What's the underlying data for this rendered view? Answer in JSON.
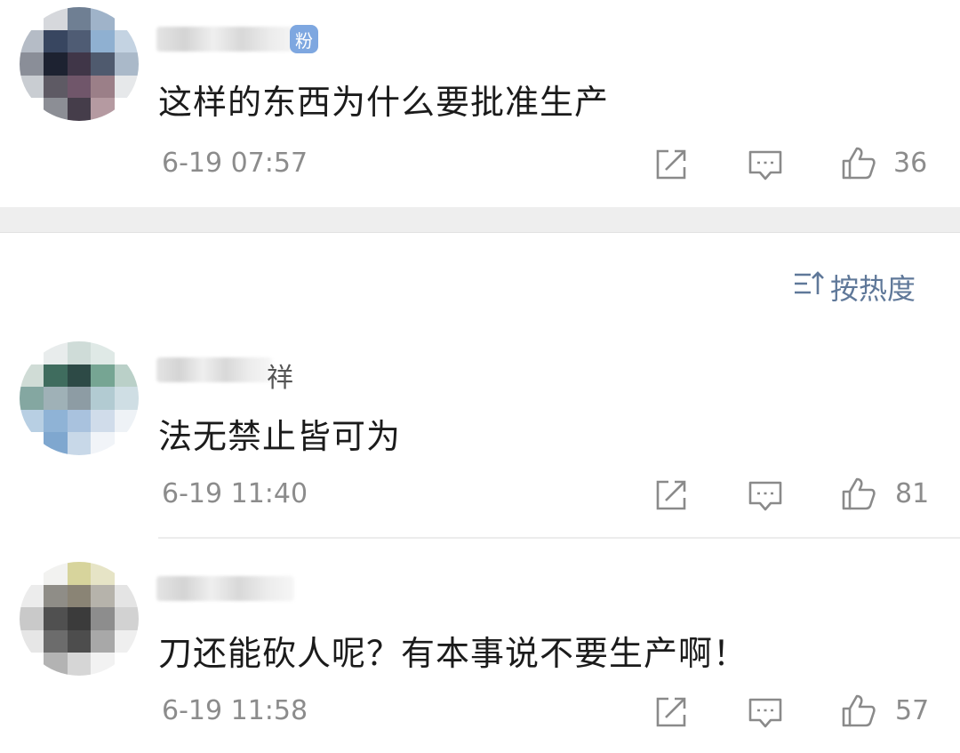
{
  "comments": [
    {
      "name_suffix": "",
      "badge": "粉",
      "text": "这样的东西为什么要批准生产",
      "time": "6-19 07:57",
      "likes": "36",
      "avatar_colors": [
        "#ffffff",
        "#d6d8dc",
        "#6f7f93",
        "#9fb3c9",
        "#ffffff",
        "#b5bcc6",
        "#384660",
        "#4f5c74",
        "#8fb0d1",
        "#c4d3e2",
        "#8a8e98",
        "#1d2231",
        "#403648",
        "#4f5a6e",
        "#aab9c9",
        "#c9cdd2",
        "#5e5a64",
        "#70566a",
        "#9b7f88",
        "#e6e8ea",
        "#ffffff",
        "#8c8e95",
        "#453d4a",
        "#b59aa1",
        "#ffffff"
      ]
    },
    {
      "name_suffix": "祥",
      "badge": "",
      "text": "法无禁止皆可为",
      "time": "6-19 11:40",
      "likes": "81",
      "avatar_colors": [
        "#ffffff",
        "#e8ecec",
        "#cfdcd8",
        "#dfe9e6",
        "#ffffff",
        "#d0dcd6",
        "#3f6c5e",
        "#2d4a46",
        "#76a593",
        "#bad0c8",
        "#84a7a1",
        "#9fb1b7",
        "#8d9ca4",
        "#b2cbd2",
        "#cfdee4",
        "#b8cfe3",
        "#8fb3d6",
        "#a9c2de",
        "#d0dcea",
        "#eef2f6",
        "#ffffff",
        "#7fa7cf",
        "#c8d8e8",
        "#f1f4f8",
        "#ffffff"
      ]
    },
    {
      "name_suffix": "",
      "badge": "",
      "text": "刀还能砍人呢？有本事说不要生产啊！",
      "time": "6-19 11:58",
      "likes": "57",
      "avatar_colors": [
        "#ffffff",
        "#f2f2f0",
        "#d7d49c",
        "#e6e4c6",
        "#ffffff",
        "#ececec",
        "#8f8d87",
        "#8a8475",
        "#b6b3ab",
        "#e4e4e4",
        "#c9c9c9",
        "#505050",
        "#3b3b3b",
        "#8d8d8d",
        "#d2d2d2",
        "#e6e6e6",
        "#6c6c6c",
        "#4d4d4d",
        "#a8a8a8",
        "#efefef",
        "#ffffff",
        "#b3b3b3",
        "#d6d6d6",
        "#f2f2f2",
        "#ffffff"
      ]
    }
  ],
  "sort": {
    "label": "按热度",
    "icon": "sort-icon"
  },
  "icons": {
    "share": "share-icon",
    "reply": "comment-icon",
    "like": "thumbs-up-icon"
  },
  "colors": {
    "meta": "#8c8c8c",
    "sort": "#5f7899",
    "badge": "#7ea7e0"
  }
}
